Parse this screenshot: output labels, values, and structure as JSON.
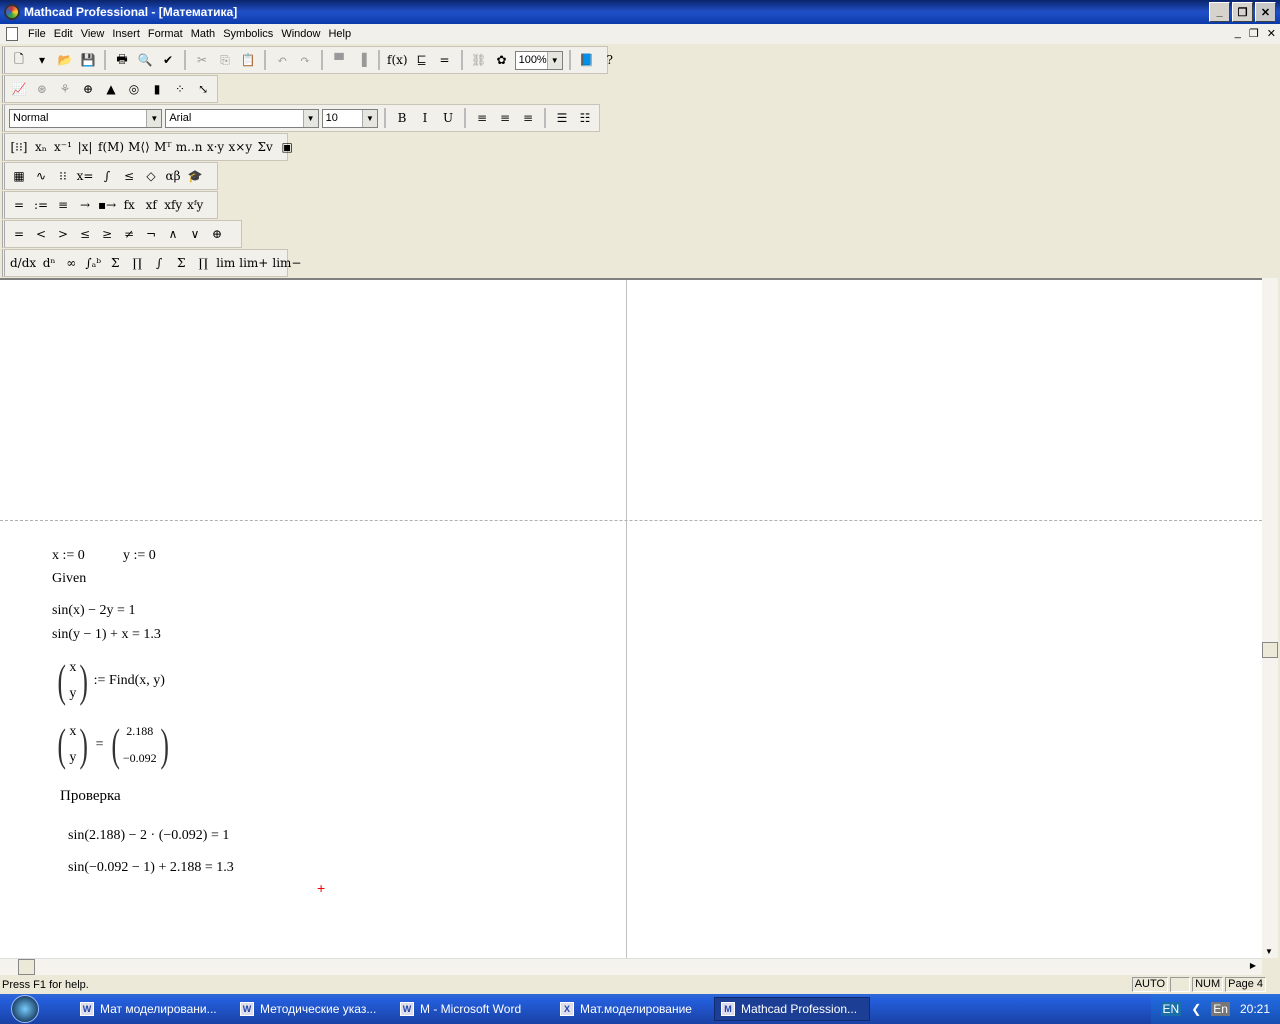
{
  "title": "Mathcad Professional - [Математика]",
  "menu": [
    "File",
    "Edit",
    "View",
    "Insert",
    "Format",
    "Math",
    "Symbolics",
    "Window",
    "Help"
  ],
  "toolbar_standard": [
    {
      "n": "new-document-icon",
      "g": "🗋"
    },
    {
      "n": "new-dropdown-icon",
      "g": "▾"
    },
    {
      "n": "open-icon",
      "g": "📂"
    },
    {
      "n": "save-icon",
      "g": "💾"
    },
    {
      "n": "sep"
    },
    {
      "n": "print-icon",
      "g": "🖶"
    },
    {
      "n": "print-preview-icon",
      "g": "🔍"
    },
    {
      "n": "spell-check-icon",
      "g": "✔"
    },
    {
      "n": "sep"
    },
    {
      "n": "cut-icon",
      "g": "✂",
      "d": 1
    },
    {
      "n": "copy-icon",
      "g": "⎘",
      "d": 1
    },
    {
      "n": "paste-icon",
      "g": "📋"
    },
    {
      "n": "sep"
    },
    {
      "n": "undo-icon",
      "g": "↶",
      "d": 1
    },
    {
      "n": "redo-icon",
      "g": "↷",
      "d": 1
    },
    {
      "n": "sep"
    },
    {
      "n": "align-across-icon",
      "g": "▀",
      "d": 1
    },
    {
      "n": "align-down-icon",
      "g": "▐",
      "d": 1
    },
    {
      "n": "sep"
    },
    {
      "n": "insert-function-icon",
      "g": "f(x)"
    },
    {
      "n": "insert-unit-icon",
      "g": "⊑"
    },
    {
      "n": "calculate-icon",
      "g": "="
    },
    {
      "n": "sep"
    },
    {
      "n": "insert-hyperlink-icon",
      "g": "⛓",
      "d": 1
    },
    {
      "n": "component-wizard-icon",
      "g": "✿"
    }
  ],
  "zoom": "100%",
  "toolbar_standard_end": [
    {
      "n": "resource-center-icon",
      "g": "📘"
    },
    {
      "n": "help-icon",
      "g": "?"
    }
  ],
  "toolbar_graph": [
    {
      "n": "xy-plot-icon",
      "g": "📈"
    },
    {
      "n": "polar-plot-icon",
      "g": "⊛",
      "d": 1
    },
    {
      "n": "surface-plot-icon",
      "g": "⚘",
      "d": 1
    },
    {
      "n": "polar-plot2-icon",
      "g": "⊕"
    },
    {
      "n": "3d-surface-icon",
      "g": "▲"
    },
    {
      "n": "contour-plot-icon",
      "g": "◎"
    },
    {
      "n": "3d-bar-icon",
      "g": "▮"
    },
    {
      "n": "scatter-plot-icon",
      "g": "⁘"
    },
    {
      "n": "vector-field-icon",
      "g": "⤡"
    }
  ],
  "format": {
    "style": "Normal",
    "font": "Arial",
    "size": "10"
  },
  "toolbar_format": [
    {
      "n": "bold-icon",
      "g": "B"
    },
    {
      "n": "italic-icon",
      "g": "I"
    },
    {
      "n": "underline-icon",
      "g": "U"
    },
    {
      "n": "sep"
    },
    {
      "n": "align-left-icon",
      "g": "≡"
    },
    {
      "n": "align-center-icon",
      "g": "≡"
    },
    {
      "n": "align-right-icon",
      "g": "≡"
    },
    {
      "n": "sep"
    },
    {
      "n": "bullets-icon",
      "g": "☰"
    },
    {
      "n": "numbering-icon",
      "g": "☷"
    }
  ],
  "palette_matrix": [
    {
      "n": "matrix-icon",
      "g": "[⁝⁝]"
    },
    {
      "n": "subscript-icon",
      "g": "xₙ"
    },
    {
      "n": "inverse-icon",
      "g": "x⁻¹"
    },
    {
      "n": "determinant-icon",
      "g": "|x|"
    },
    {
      "n": "vectorize-icon",
      "g": "f(M)"
    },
    {
      "n": "column-icon",
      "g": "M⟨⟩"
    },
    {
      "n": "transpose-icon",
      "g": "Mᵀ"
    },
    {
      "n": "range-icon",
      "g": "m..n"
    },
    {
      "n": "dot-product-icon",
      "g": "x·y"
    },
    {
      "n": "cross-product-icon",
      "g": "x×y"
    },
    {
      "n": "vector-sum-icon",
      "g": "Σv"
    },
    {
      "n": "picture-icon",
      "g": "▣"
    }
  ],
  "palette_math": [
    {
      "n": "calculator-toolbar-icon",
      "g": "▦"
    },
    {
      "n": "graph-toolbar-icon",
      "g": "∿"
    },
    {
      "n": "matrix-toolbar-icon",
      "g": "⁝⁝"
    },
    {
      "n": "evaluation-toolbar-icon",
      "g": "x="
    },
    {
      "n": "calculus-toolbar-icon",
      "g": "∫"
    },
    {
      "n": "boolean-toolbar-icon",
      "g": "≤"
    },
    {
      "n": "programming-toolbar-icon",
      "g": "◇"
    },
    {
      "n": "greek-toolbar-icon",
      "g": "αβ"
    },
    {
      "n": "symbolic-toolbar-icon",
      "g": "🎓"
    }
  ],
  "palette_eval": [
    {
      "n": "evaluate-icon",
      "g": "="
    },
    {
      "n": "define-icon",
      "g": ":="
    },
    {
      "n": "global-define-icon",
      "g": "≡"
    },
    {
      "n": "symbolic-eval-icon",
      "g": "→"
    },
    {
      "n": "symbolic-keyword-icon",
      "g": "▪→"
    },
    {
      "n": "prefix-operator-icon",
      "g": "fx"
    },
    {
      "n": "postfix-operator-icon",
      "g": "xf"
    },
    {
      "n": "infix-operator-icon",
      "g": "xfy"
    },
    {
      "n": "treefix-operator-icon",
      "g": "xᶠy"
    }
  ],
  "palette_boolean": [
    {
      "n": "equal-icon",
      "g": "="
    },
    {
      "n": "less-than-icon",
      "g": "<"
    },
    {
      "n": "greater-than-icon",
      "g": ">"
    },
    {
      "n": "less-equal-icon",
      "g": "≤"
    },
    {
      "n": "greater-equal-icon",
      "g": "≥"
    },
    {
      "n": "not-equal-icon",
      "g": "≠"
    },
    {
      "n": "not-icon",
      "g": "¬"
    },
    {
      "n": "and-icon",
      "g": "∧"
    },
    {
      "n": "or-icon",
      "g": "∨"
    },
    {
      "n": "xor-icon",
      "g": "⊕"
    }
  ],
  "palette_calculus": [
    {
      "n": "derivative-icon",
      "g": "d/dx"
    },
    {
      "n": "nth-derivative-icon",
      "g": "dⁿ"
    },
    {
      "n": "infinity-icon",
      "g": "∞"
    },
    {
      "n": "definite-integral-icon",
      "g": "∫ₐᵇ"
    },
    {
      "n": "range-sum-icon",
      "g": "Σ"
    },
    {
      "n": "range-product-icon",
      "g": "∏"
    },
    {
      "n": "indefinite-integral-icon",
      "g": "∫"
    },
    {
      "n": "sum-icon",
      "g": "Σ"
    },
    {
      "n": "product-icon",
      "g": "∏"
    },
    {
      "n": "limit-icon",
      "g": "lim"
    },
    {
      "n": "right-limit-icon",
      "g": "lim+"
    },
    {
      "n": "left-limit-icon",
      "g": "lim−"
    }
  ],
  "worksheet": {
    "line1a": "x := 0",
    "line1b": "y := 0",
    "given": "Given",
    "eq1": "sin(x) − 2y = 1",
    "eq2": "sin(y − 1) + x = 1.3",
    "vec_x": "x",
    "vec_y": "y",
    "find": ":= Find(x, y)",
    "equals": "=",
    "res_x": "2.188",
    "res_y": "−0.092",
    "check_label": "Проверка",
    "check1": "sin(2.188) − 2 · (−0.092) = 1",
    "check2": "sin(−0.092 − 1) + 2.188 = 1.3"
  },
  "status": {
    "help": "Press F1 for help.",
    "mode": "AUTO",
    "caps": "",
    "num": "NUM",
    "page": "Page 4"
  },
  "taskbar": [
    {
      "label": "Мат моделировани...",
      "icon": "W"
    },
    {
      "label": "Методические указ...",
      "icon": "W"
    },
    {
      "label": "M - Microsoft Word",
      "icon": "W"
    },
    {
      "label": "Мат.моделирование",
      "icon": "X"
    },
    {
      "label": "Mathcad Profession...",
      "icon": "M",
      "active": true
    }
  ],
  "tray": {
    "lang": "EN",
    "lang2": "En",
    "time": "20:21"
  }
}
